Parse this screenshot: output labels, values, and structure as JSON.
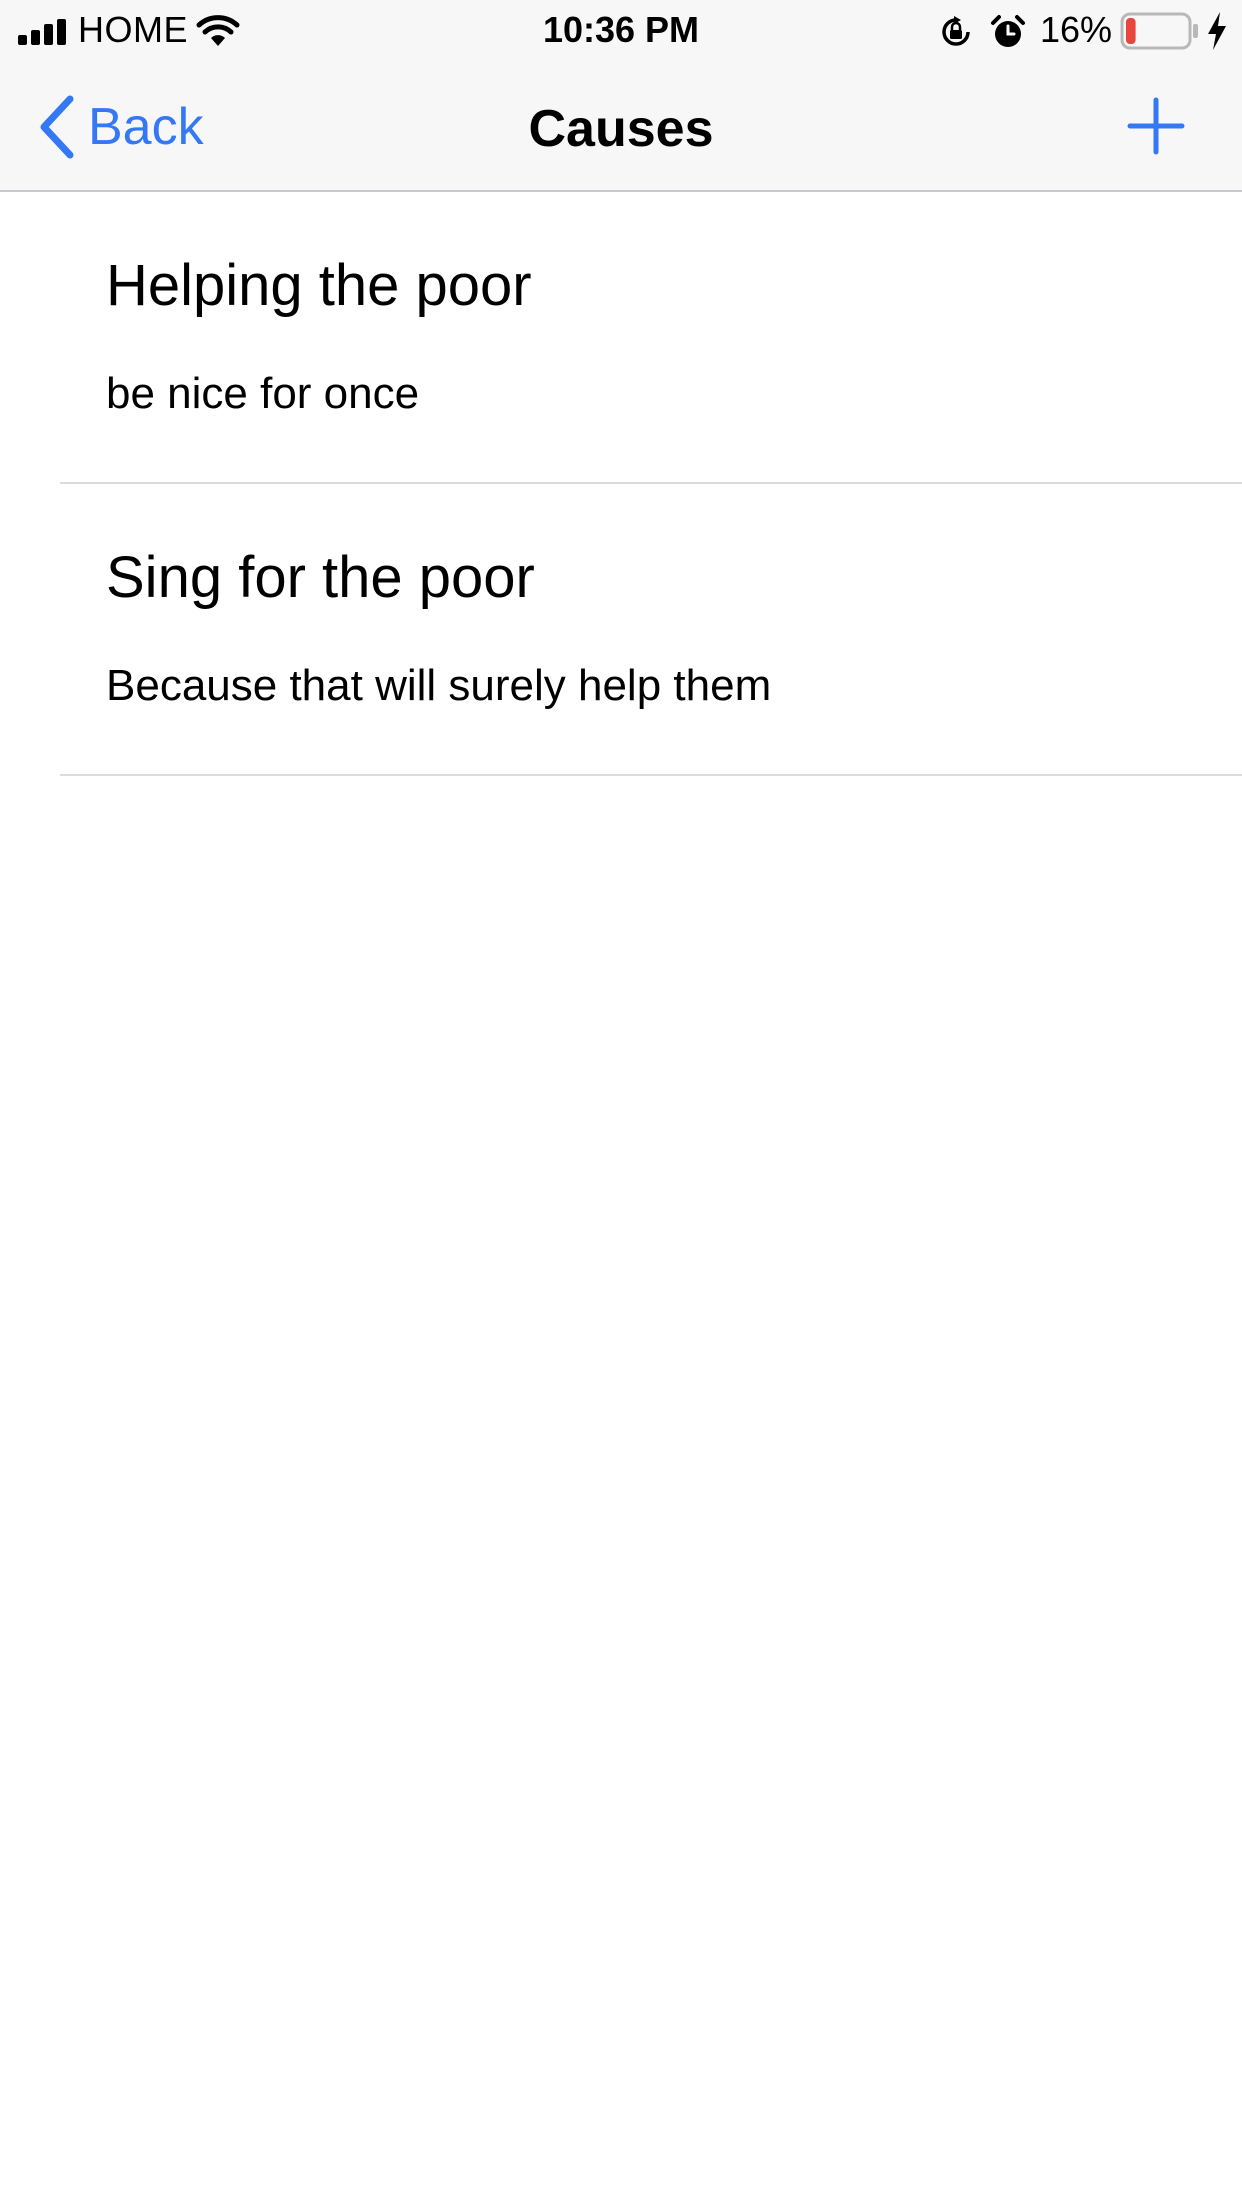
{
  "status_bar": {
    "carrier": "HOME",
    "time": "10:36 PM",
    "battery_percent": "16%",
    "battery_level": 0.16,
    "battery_color": "#e8453c",
    "icons": [
      "signal-icon",
      "wifi-icon",
      "rotation-lock-icon",
      "alarm-icon",
      "battery-icon",
      "charging-icon"
    ]
  },
  "nav": {
    "back_label": "Back",
    "title": "Causes",
    "add_icon": "plus-icon",
    "accent_color": "#3478f6"
  },
  "causes": [
    {
      "title": "Helping the poor",
      "description": "be nice for once"
    },
    {
      "title": "Sing for the poor",
      "description": "Because that will surely help them"
    }
  ]
}
